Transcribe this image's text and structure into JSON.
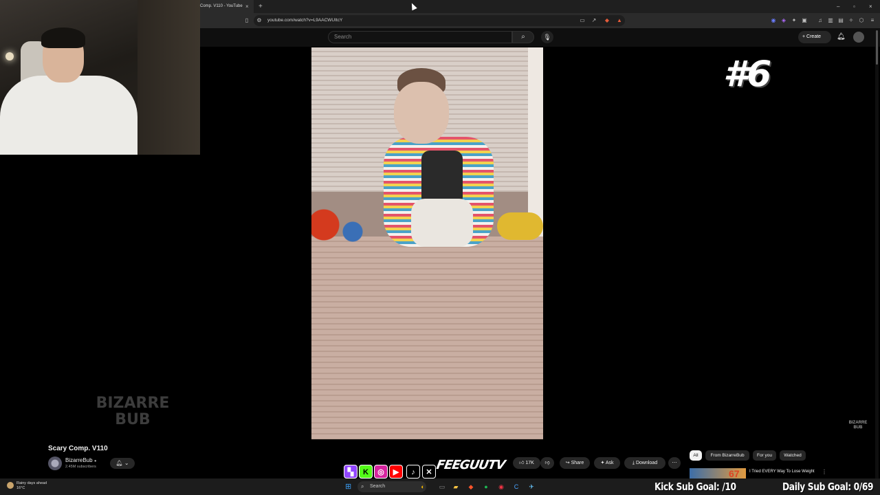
{
  "browser": {
    "tab_title": "Comp. V110 - YouTube",
    "new_tab_icon": "+",
    "close_tab_icon": "×",
    "url": "youtube.com/watch?v=L9AACWUItcY",
    "window_controls": {
      "minimize": "–",
      "restore": "▫",
      "close": "×"
    }
  },
  "youtube": {
    "search_placeholder": "Search",
    "create_label": "Create",
    "video": {
      "title": "Scary Comp. V110",
      "channel_name": "BizarreBub",
      "verified_icon": "check-circle-icon",
      "subscribers": "2.45M subscribers",
      "likes": "17K",
      "share_label": "Share",
      "ask_label": "Ask",
      "download_label": "Download"
    },
    "chips": [
      "All",
      "From BizarreBub",
      "For you",
      "Watched"
    ],
    "recommendation": {
      "thumb_text": "67",
      "title": "I Tried EVERY Way To Lose Weight"
    }
  },
  "overlay": {
    "rank": "#6",
    "watermark_left": "BIZARRE BUB",
    "watermark_right": "BIZARRE BUB",
    "social_handle": "FEEGUUTV",
    "kick_goal": "Kick Sub Goal: /10",
    "daily_goal": "Daily Sub Goal: 0/69"
  },
  "taskbar": {
    "weather_text": "Rainy days ahead",
    "weather_temp": "16°C",
    "search_label": "Search"
  },
  "colors": {
    "youtube_bg": "#0f0f0f",
    "chip_bg": "#272727",
    "windows_blue": "#3a9bf0"
  }
}
